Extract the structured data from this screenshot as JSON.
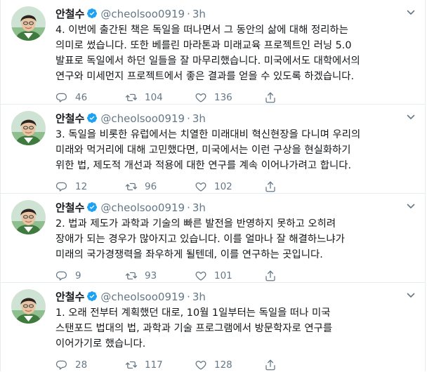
{
  "tweets": [
    {
      "name": "안철수",
      "handle": "@cheolsoo0919",
      "dot": "·",
      "time": "3h",
      "text": "4. 이번에 출간된 책은 독일을 떠나면서 그 동안의 삶에 대해 정리하는 의미로 썼습니다. 또한 베를린 마라톤과 미래교육 프로젝트인 러닝 5.0 발표로 독일에서 하던 일들을 잘 마무리했습니다. 미국에서도 대학에서의 연구와 미세먼지 프로젝트에서 좋은 결과를 얻을 수 있도록 하겠습니다.",
      "replies": "46",
      "retweets": "104",
      "likes": "136"
    },
    {
      "name": "안철수",
      "handle": "@cheolsoo0919",
      "dot": "·",
      "time": "3h",
      "text": "3. 독일을 비롯한 유럽에서는 치열한 미래대비 혁신현장을 다니며 우리의 미래와 먹거리에 대해 고민했다면, 미국에서는 이런 구상을 현실화하기 위한 법, 제도적 개선과 적용에 대한 연구를 계속 이어나가려고 합니다.",
      "replies": "12",
      "retweets": "96",
      "likes": "102"
    },
    {
      "name": "안철수",
      "handle": "@cheolsoo0919",
      "dot": "·",
      "time": "3h",
      "text": "2. 법과 제도가 과학과 기술의 빠른 발전을 반영하지 못하고 오히려 장애가 되는 경우가 많아지고 있습니다. 이를 얼마나 잘 해결하느냐가 미래의 국가경쟁력을 좌우하게 될텐데, 이를 연구하는 곳입니다.",
      "replies": "9",
      "retweets": "93",
      "likes": "101"
    },
    {
      "name": "안철수",
      "handle": "@cheolsoo0919",
      "dot": "·",
      "time": "3h",
      "text": "1. 오래 전부터 계획했던 대로, 10월 1일부터는 독일을 떠나 미국 스탠포드 법대의 법, 과학과 기술 프로그램에서 방문학자로 연구를 이어가기로 했습니다.",
      "replies": "28",
      "retweets": "117",
      "likes": "128"
    }
  ],
  "colors": {
    "text": "#14171a",
    "secondary": "#657786",
    "verified": "#1da1f2",
    "border": "#e6ecf0"
  }
}
